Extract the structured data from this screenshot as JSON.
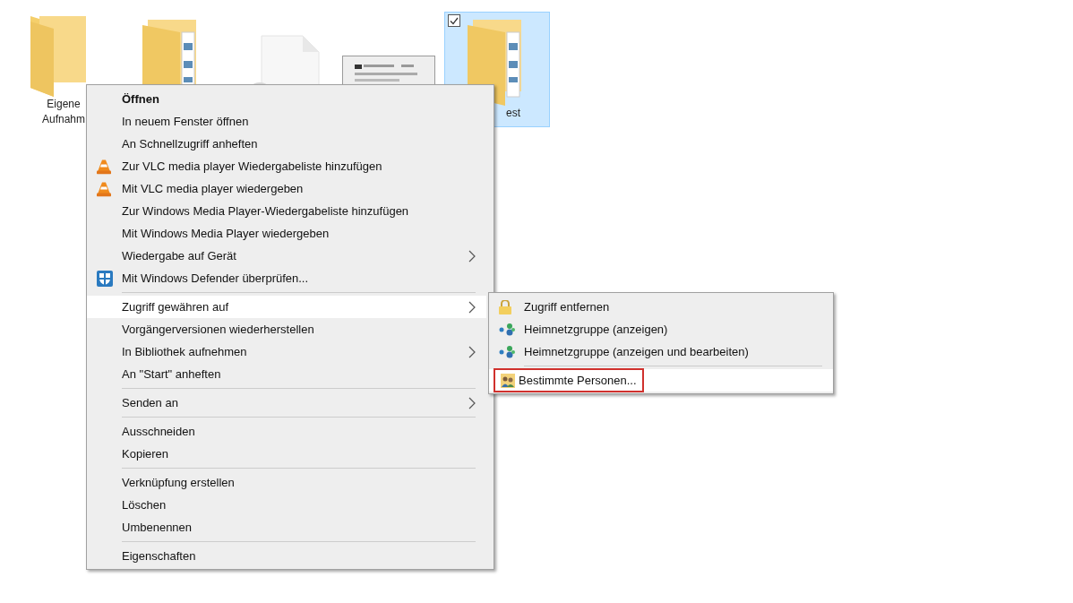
{
  "desktop_items": [
    {
      "kind": "folder",
      "label_lines": [
        "Eigene",
        "Aufnahm"
      ],
      "selected": false
    },
    {
      "kind": "folder-docs",
      "selected": false
    },
    {
      "kind": "file-gear",
      "selected": false
    },
    {
      "kind": "document",
      "selected": false
    },
    {
      "kind": "folder-docs",
      "label_lines": [
        "est"
      ],
      "selected": true,
      "checked": true
    }
  ],
  "context_menu": {
    "items": [
      {
        "kind": "item",
        "label": "Öffnen",
        "default": true,
        "selected": false,
        "submenu": false
      },
      {
        "kind": "item",
        "label": "In neuem Fenster öffnen",
        "default": false,
        "selected": false,
        "submenu": false
      },
      {
        "kind": "item",
        "label": "An Schnellzugriff anheften",
        "default": false,
        "selected": false,
        "submenu": false
      },
      {
        "kind": "cone",
        "label": "Zur VLC media player Wiedergabeliste hinzufügen",
        "default": false,
        "selected": false,
        "submenu": false
      },
      {
        "kind": "cone",
        "label": "Mit VLC media player wiedergeben",
        "default": false,
        "selected": false,
        "submenu": false
      },
      {
        "kind": "item",
        "label": "Zur Windows Media Player-Wiedergabeliste hinzufügen",
        "default": false,
        "selected": false,
        "submenu": false
      },
      {
        "kind": "item",
        "label": "Mit Windows Media Player wiedergeben",
        "default": false,
        "selected": false,
        "submenu": false
      },
      {
        "kind": "item",
        "label": "Wiedergabe auf Gerät",
        "default": false,
        "selected": false,
        "submenu": true
      },
      {
        "kind": "shield",
        "label": "Mit Windows Defender überprüfen...",
        "default": false,
        "selected": false,
        "submenu": false
      },
      {
        "kind": "separator"
      },
      {
        "kind": "item",
        "label": "Zugriff gewähren auf",
        "default": false,
        "selected": true,
        "submenu": true
      },
      {
        "kind": "item",
        "label": "Vorgängerversionen wiederherstellen",
        "default": false,
        "selected": false,
        "submenu": false
      },
      {
        "kind": "item",
        "label": "In Bibliothek aufnehmen",
        "default": false,
        "selected": false,
        "submenu": true
      },
      {
        "kind": "item",
        "label": "An \"Start\" anheften",
        "default": false,
        "selected": false,
        "submenu": false
      },
      {
        "kind": "separator"
      },
      {
        "kind": "item",
        "label": "Senden an",
        "default": false,
        "selected": false,
        "submenu": true
      },
      {
        "kind": "separator"
      },
      {
        "kind": "item",
        "label": "Ausschneiden",
        "default": false,
        "selected": false,
        "submenu": false
      },
      {
        "kind": "item",
        "label": "Kopieren",
        "default": false,
        "selected": false,
        "submenu": false
      },
      {
        "kind": "separator"
      },
      {
        "kind": "item",
        "label": "Verknüpfung erstellen",
        "default": false,
        "selected": false,
        "submenu": false
      },
      {
        "kind": "item",
        "label": "Löschen",
        "default": false,
        "selected": false,
        "submenu": false
      },
      {
        "kind": "item",
        "label": "Umbenennen",
        "default": false,
        "selected": false,
        "submenu": false
      },
      {
        "kind": "separator"
      },
      {
        "kind": "item",
        "label": "Eigenschaften",
        "default": false,
        "selected": false,
        "submenu": false
      }
    ]
  },
  "submenu": {
    "items": [
      {
        "kind": "lock",
        "label": "Zugriff entfernen",
        "selected": false,
        "outlined": false
      },
      {
        "kind": "network",
        "label": "Heimnetzgruppe (anzeigen)",
        "selected": false,
        "outlined": false
      },
      {
        "kind": "network",
        "label": "Heimnetzgruppe (anzeigen und bearbeiten)",
        "selected": false,
        "outlined": false
      },
      {
        "kind": "separator"
      },
      {
        "kind": "people",
        "label": "Bestimmte Personen...",
        "selected": true,
        "outlined": true
      }
    ]
  }
}
